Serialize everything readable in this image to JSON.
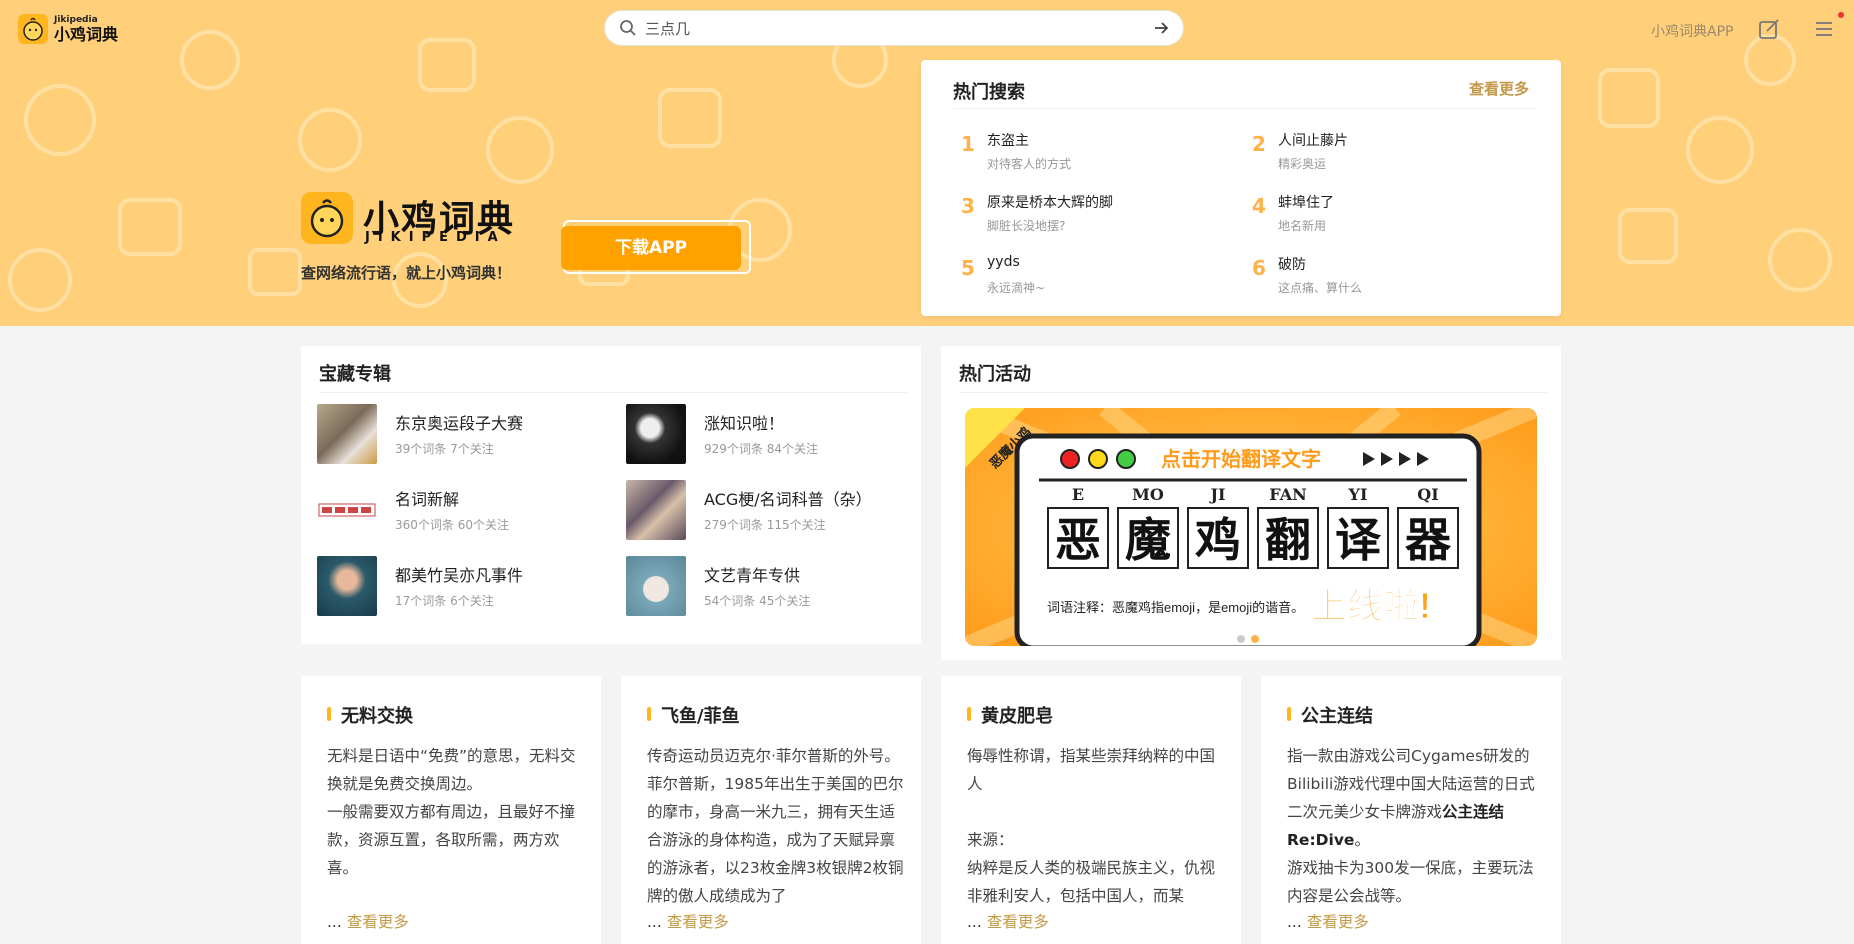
{
  "header": {
    "logo_small_en": "Jikipedia",
    "logo_small_zh": "小鸡词典",
    "search_value": "三点几",
    "app_link": "小鸡词典APP"
  },
  "hero": {
    "brand_zh": "小鸡词典",
    "brand_en": "JIKIPEDIA",
    "slogan": "查网络流行语，就上小鸡词典！",
    "download_label": "下载APP"
  },
  "hot_search": {
    "title": "热门搜索",
    "more": "查看更多",
    "items": [
      {
        "rank": "1",
        "word": "东盗主",
        "desc": "对待客人的方式"
      },
      {
        "rank": "2",
        "word": "人间止藤片",
        "desc": "精彩奥运"
      },
      {
        "rank": "3",
        "word": "原来是桥本大辉的脚",
        "desc": "脚脏长没地摆?"
      },
      {
        "rank": "4",
        "word": "蚌埠住了",
        "desc": "地名新用"
      },
      {
        "rank": "5",
        "word": "yyds",
        "desc": "永远滴神~"
      },
      {
        "rank": "6",
        "word": "破防",
        "desc": "这点痛、算什么"
      }
    ]
  },
  "treasure": {
    "title": "宝藏专辑",
    "items": [
      {
        "name": "东京奥运段子大赛",
        "meta": "39个词条  7个关注"
      },
      {
        "name": "涨知识啦！",
        "meta": "929个词条  84个关注"
      },
      {
        "name": "名词新解",
        "meta": "360个词条  60个关注"
      },
      {
        "name": "ACG梗/名词科普（杂）",
        "meta": "279个词条  115个关注"
      },
      {
        "name": "都美竹吴亦凡事件",
        "meta": "17个词条  6个关注"
      },
      {
        "name": "文艺青年专供",
        "meta": "54个词条  45个关注"
      }
    ]
  },
  "activity": {
    "title": "热门活动",
    "banner": {
      "ribbon": "恶魔小鸡",
      "prompt": "点击开始翻译文字",
      "pinyin": [
        "E",
        "MO",
        "JI",
        "FAN",
        "YI",
        "QI"
      ],
      "chars": [
        "恶",
        "魔",
        "鸡",
        "翻",
        "译",
        "器"
      ],
      "note": "词语注释：恶魔鸡指emoji，是emoji的谐音。",
      "launch": "上线啦!"
    }
  },
  "cards": [
    {
      "title": "无料交换",
      "paragraphs": [
        "无料是日语中“免费”的意思，无料交换就是免费交换周边。",
        "一般需要双方都有周边，且最好不撞款，资源互置，各取所需，两方欢喜。"
      ],
      "more_prefix": "... ",
      "more": "查看更多"
    },
    {
      "title": "飞鱼/菲鱼",
      "paragraphs": [
        "传奇运动员迈克尔·菲尔普斯的外号。菲尔普斯，1985年出生于美国的巴尔的摩市，身高一米九三，拥有天生适合游泳的身体构造，成为了天赋异禀的游泳者，以23枚金牌3枚银牌2枚铜牌的傲人成绩成为了"
      ],
      "more_prefix": "... ",
      "more": "查看更多"
    },
    {
      "title": "黄皮肥皂",
      "paragraphs": [
        "侮辱性称谓，指某些崇拜纳粹的中国人",
        "",
        "来源：",
        "纳粹是反人类的极端民族主义，仇视非雅利安人，包括中国人，而某"
      ],
      "more_prefix": "... ",
      "more": "查看更多"
    },
    {
      "title": "公主连结",
      "paragraphs_html": true,
      "p1a": "指一款由游戏公司Cygames研发的Bilibili游戏代理中国大陆运营的日式二次元美少女卡牌游戏",
      "p1b": "公主连结Re:Dive",
      "p1c": "。",
      "p2": "游戏抽卡为300发一保底，主要玩法内容是公会战等。",
      "more_prefix": "... ",
      "more": "查看更多"
    }
  ],
  "colors": {
    "hero_bg": "#ffcf7a",
    "accent": "#ffa200",
    "rank": "#ffb24a",
    "link": "#c49a4a"
  }
}
